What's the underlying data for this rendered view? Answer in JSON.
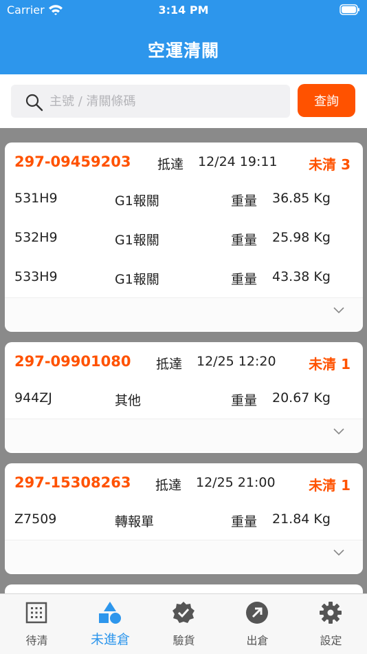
{
  "status_bar": {
    "carrier": "Carrier",
    "time": "3:14 PM"
  },
  "nav": {
    "title": "空運清關"
  },
  "search": {
    "placeholder": "主號 / 清關條碼",
    "button_label": "查詢"
  },
  "cards": [
    {
      "awb": "297-09459203",
      "arrive_label": "抵達",
      "arrive_time": "12/24 19:11",
      "status": "未清 3",
      "items": [
        {
          "code": "531H9",
          "type": "G1報關",
          "weight_label": "重量",
          "weight": "36.85 Kg"
        },
        {
          "code": "532H9",
          "type": "G1報關",
          "weight_label": "重量",
          "weight": "25.98 Kg"
        },
        {
          "code": "533H9",
          "type": "G1報關",
          "weight_label": "重量",
          "weight": "43.38 Kg"
        }
      ]
    },
    {
      "awb": "297-09901080",
      "arrive_label": "抵達",
      "arrive_time": "12/25 12:20",
      "status": "未清 1",
      "items": [
        {
          "code": "944ZJ",
          "type": "其他",
          "weight_label": "重量",
          "weight": "20.67 Kg"
        }
      ]
    },
    {
      "awb": "297-15308263",
      "arrive_label": "抵達",
      "arrive_time": "12/25 21:00",
      "status": "未清 1",
      "items": [
        {
          "code": "Z7509",
          "type": "轉報單",
          "weight_label": "重量",
          "weight": "21.84 Kg"
        }
      ]
    }
  ],
  "tabs": [
    {
      "label": "待清",
      "icon": "grid-icon",
      "active": false
    },
    {
      "label": "未進倉",
      "icon": "shapes-icon",
      "active": true
    },
    {
      "label": "驗貨",
      "icon": "verified-badge-icon",
      "active": false
    },
    {
      "label": "出倉",
      "icon": "arrow-up-right-circle-icon",
      "active": false
    },
    {
      "label": "設定",
      "icon": "gear-icon",
      "active": false
    }
  ],
  "colors": {
    "primary": "#2d96ec",
    "accent": "#ff5200",
    "inactive": "#555555"
  }
}
